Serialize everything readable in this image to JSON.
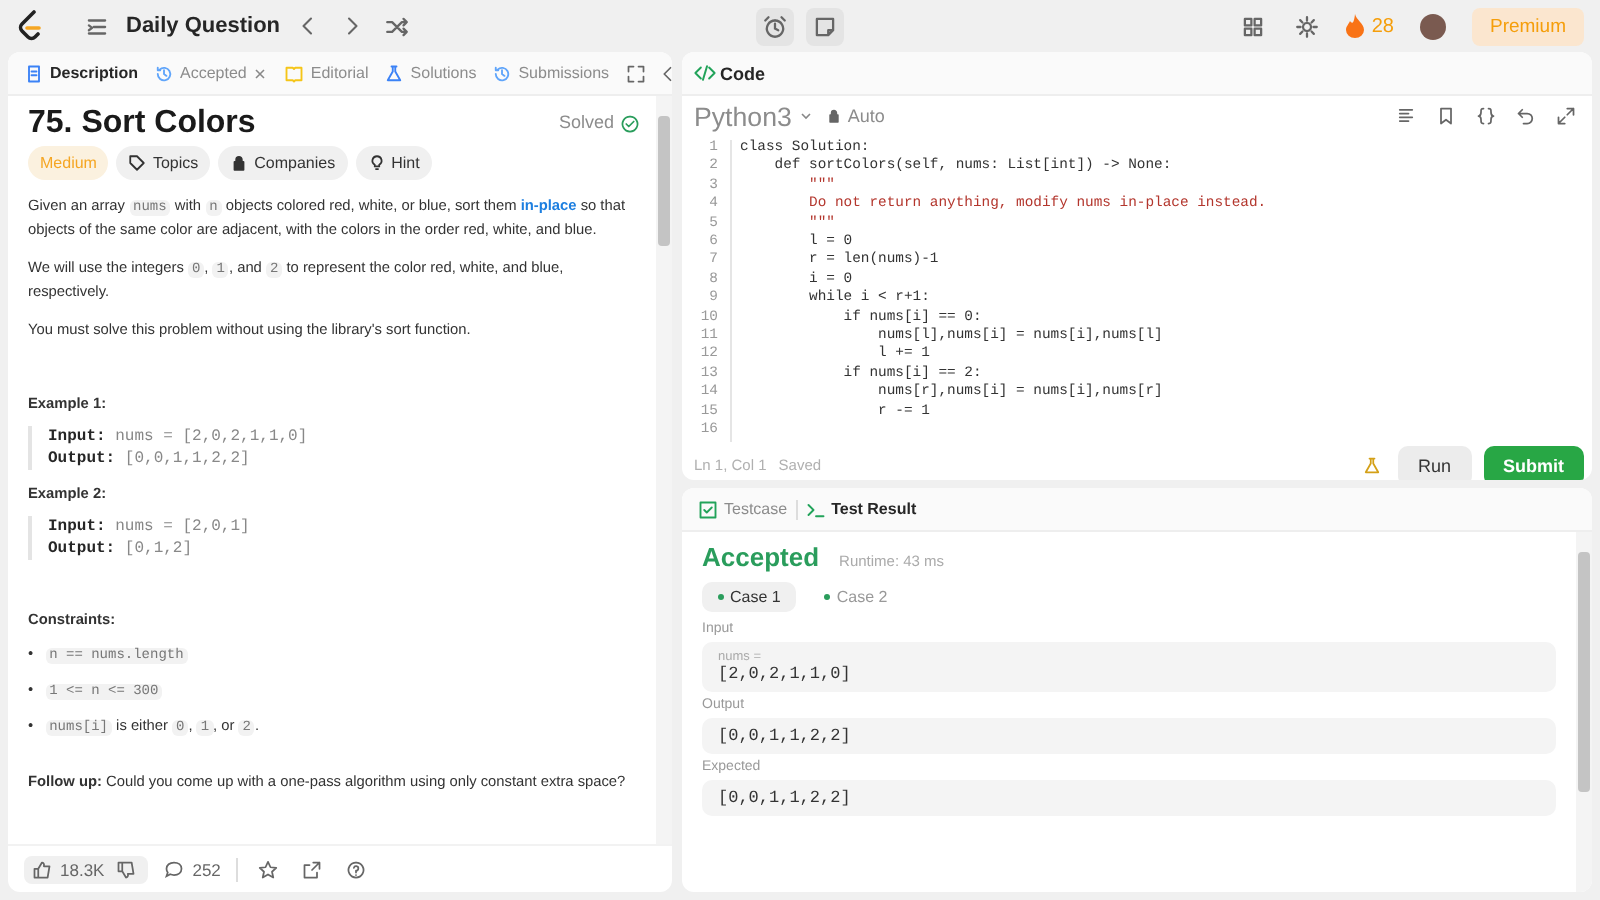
{
  "nav": {
    "title": "Daily Question",
    "streak": "28",
    "premium": "Premium"
  },
  "tabs": [
    {
      "label": "Description",
      "selected": true,
      "closable": false,
      "kind": "doc"
    },
    {
      "label": "Accepted",
      "selected": false,
      "closable": true,
      "kind": "history"
    },
    {
      "label": "Editorial",
      "selected": false,
      "closable": false,
      "kind": "book"
    },
    {
      "label": "Solutions",
      "selected": false,
      "closable": false,
      "kind": "flask"
    },
    {
      "label": "Submissions",
      "selected": false,
      "closable": false,
      "kind": "history"
    }
  ],
  "problem": {
    "title": "75. Sort Colors",
    "status": "Solved",
    "difficulty": "Medium",
    "tags": [
      {
        "label": "Topics",
        "kind": "tag"
      },
      {
        "label": "Companies",
        "kind": "lock"
      },
      {
        "label": "Hint",
        "kind": "bulb"
      }
    ],
    "paragraphs": [
      [
        {
          "kind": "text",
          "text": "Given an array "
        },
        {
          "kind": "code",
          "text": "nums"
        },
        {
          "kind": "text",
          "text": " with "
        },
        {
          "kind": "code",
          "text": "n"
        },
        {
          "kind": "text",
          "text": " objects colored red, white, or blue, sort them "
        },
        {
          "kind": "strong",
          "text": "in-place"
        },
        {
          "kind": "text",
          "text": " so that objects of the same color are adjacent, with the colors in the order red, white, and blue."
        }
      ],
      [
        {
          "kind": "text",
          "text": "We will use the integers "
        },
        {
          "kind": "code",
          "text": "0"
        },
        {
          "kind": "text",
          "text": ", "
        },
        {
          "kind": "code",
          "text": "1"
        },
        {
          "kind": "text",
          "text": ", and "
        },
        {
          "kind": "code",
          "text": "2"
        },
        {
          "kind": "text",
          "text": " to represent the color red, white, and blue, respectively."
        }
      ],
      [
        {
          "kind": "text",
          "text": "You must solve this problem without using the library's sort function."
        }
      ]
    ],
    "examples": [
      {
        "title": "Example 1:",
        "lines": [
          {
            "label": "Input:",
            "value": "nums = [2,0,2,1,1,0]"
          },
          {
            "label": "Output:",
            "value": "[0,0,1,1,2,2]"
          }
        ]
      },
      {
        "title": "Example 2:",
        "lines": [
          {
            "label": "Input:",
            "value": "nums = [2,0,1]"
          },
          {
            "label": "Output:",
            "value": "[0,1,2]"
          }
        ]
      }
    ],
    "constraints": {
      "title": "Constraints:",
      "items": [
        {
          "bullet": "•",
          "parts": [
            {
              "kind": "code",
              "text": "n == nums.length"
            }
          ]
        },
        {
          "bullet": "•",
          "parts": [
            {
              "kind": "code",
              "text": "1 <= n <= 300"
            }
          ]
        },
        {
          "bullet": "•",
          "parts": [
            {
              "kind": "code",
              "text": "nums[i]"
            },
            {
              "kind": "text",
              "text": " is either "
            },
            {
              "kind": "code",
              "text": "0"
            },
            {
              "kind": "text",
              "text": ", "
            },
            {
              "kind": "code",
              "text": "1"
            },
            {
              "kind": "text",
              "text": ", or "
            },
            {
              "kind": "code",
              "text": "2"
            },
            {
              "kind": "text",
              "text": "."
            }
          ]
        }
      ]
    },
    "follow_up": "**Follow up:** Could you come up with a one-pass algorithm using only constant extra space?",
    "likes": "18.3K",
    "comments": "252"
  },
  "editor": {
    "title": "Code",
    "language": "Python3",
    "mode": "Auto",
    "lines": [
      {
        "number": "1",
        "kind": "code",
        "text": "class Solution:"
      },
      {
        "number": "2",
        "kind": "code",
        "text": "    def sortColors(self, nums: List[int]) -> None:"
      },
      {
        "number": "3",
        "kind": "string",
        "text": "        \"\"\""
      },
      {
        "number": "4",
        "kind": "string",
        "text": "        Do not return anything, modify nums in-place instead."
      },
      {
        "number": "5",
        "kind": "string",
        "text": "        \"\"\""
      },
      {
        "number": "6",
        "kind": "code",
        "text": "        l = 0"
      },
      {
        "number": "7",
        "kind": "code",
        "text": "        r = len(nums)-1"
      },
      {
        "number": "8",
        "kind": "code",
        "text": "        i = 0"
      },
      {
        "number": "9",
        "kind": "code",
        "text": "        while i < r+1:"
      },
      {
        "number": "10",
        "kind": "code",
        "text": "            if nums[i] == 0:"
      },
      {
        "number": "11",
        "kind": "code",
        "text": "                nums[l],nums[i] = nums[i],nums[l]"
      },
      {
        "number": "12",
        "kind": "code",
        "text": "                l += 1"
      },
      {
        "number": "13",
        "kind": "code",
        "text": "            if nums[i] == 2:"
      },
      {
        "number": "14",
        "kind": "code",
        "text": "                nums[r],nums[i] = nums[i],nums[r]"
      },
      {
        "number": "15",
        "kind": "code",
        "text": "                r -= 1"
      },
      {
        "number": "16",
        "kind": "blank"
      }
    ],
    "position": "Ln 1, Col 1",
    "saved": "Saved",
    "run": "Run",
    "submit": "Submit"
  },
  "results": {
    "tabs": [
      {
        "label": "Testcase",
        "selected": false,
        "kind": "check"
      },
      {
        "label": "Test Result",
        "selected": true,
        "kind": "terminal"
      }
    ],
    "verdict": "Accepted",
    "runtime": "Runtime: 43 ms",
    "cases": [
      {
        "label": "Case 1",
        "selected": true
      },
      {
        "label": "Case 2",
        "selected": false
      }
    ],
    "sections": [
      {
        "label": "Input",
        "variable": "nums =",
        "value": "[2,0,2,1,1,0]"
      },
      {
        "label": "Output",
        "value": "[0,0,1,1,2,2]"
      },
      {
        "label": "Expected",
        "value": "[0,0,1,1,2,2]"
      }
    ]
  }
}
